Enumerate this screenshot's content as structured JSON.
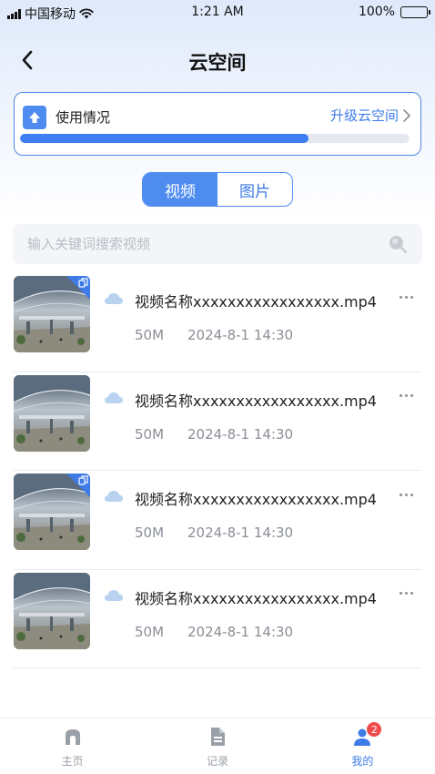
{
  "status_bar": {
    "carrier": "中国移动",
    "time": "1:21 AM",
    "battery": "100%"
  },
  "nav": {
    "title": "云空间"
  },
  "usage": {
    "label": "使用情况",
    "upgrade_label": "升级云空间",
    "used_fraction": 0.74
  },
  "segment": {
    "tabs": [
      {
        "label": "视频",
        "active": true
      },
      {
        "label": "图片",
        "active": false
      }
    ]
  },
  "search": {
    "placeholder": "输入关键词搜索视频",
    "value": ""
  },
  "files": [
    {
      "name": "视频名称xxxxxxxxxxxxxxxxx.mp4",
      "size": "50M",
      "date": "2024-8-1 14:30",
      "shared": true
    },
    {
      "name": "视频名称xxxxxxxxxxxxxxxxx.mp4",
      "size": "50M",
      "date": "2024-8-1 14:30",
      "shared": false
    },
    {
      "name": "视频名称xxxxxxxxxxxxxxxxx.mp4",
      "size": "50M",
      "date": "2024-8-1 14:30",
      "shared": true
    },
    {
      "name": "视频名称xxxxxxxxxxxxxxxxx.mp4",
      "size": "50M",
      "date": "2024-8-1 14:30",
      "shared": false
    }
  ],
  "tabbar": {
    "items": [
      {
        "label": "主页",
        "icon": "home-icon",
        "active": false
      },
      {
        "label": "记录",
        "icon": "document-icon",
        "active": false
      },
      {
        "label": "我的",
        "icon": "user-icon",
        "active": true,
        "badge": "2"
      }
    ]
  },
  "colors": {
    "accent": "#3e7be6",
    "progress": "#3d7ef0",
    "badge": "#ef4b4b"
  }
}
